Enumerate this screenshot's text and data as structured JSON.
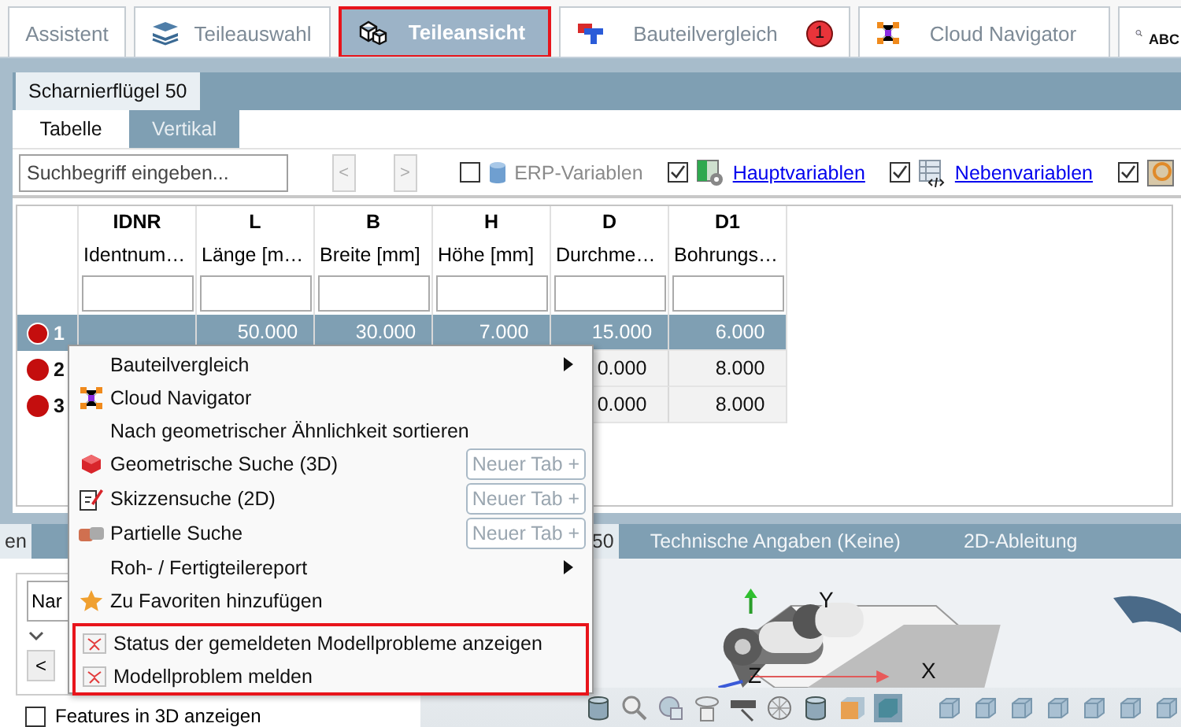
{
  "top_tabs": [
    {
      "label": "Assistent",
      "selected": false,
      "highlighted": false
    },
    {
      "label": "Teileauswahl",
      "selected": false,
      "highlighted": false
    },
    {
      "label": "Teileansicht",
      "selected": true,
      "highlighted": true
    },
    {
      "label": "Bauteilvergleich",
      "selected": false,
      "highlighted": false,
      "badge": "1"
    },
    {
      "label": "Cloud Navigator",
      "selected": false,
      "highlighted": false
    },
    {
      "label": "ABC",
      "selected": false,
      "highlighted": false
    }
  ],
  "document_tab": {
    "label": "Scharnierflügel 50",
    "selected": true
  },
  "view_tabs": [
    {
      "label": "Tabelle",
      "selected": true
    },
    {
      "label": "Vertikal",
      "selected": false
    }
  ],
  "toolbar": {
    "search": {
      "placeholder": "Suchbegriff eingeben..."
    },
    "nav_buttons": [
      {
        "label": "<",
        "disabled": true
      },
      {
        "label": ">",
        "disabled": true
      }
    ],
    "options": [
      {
        "label": "ERP-Variablen",
        "checked": false,
        "kind": "text"
      },
      {
        "label": "Hauptvariablen",
        "checked": true,
        "kind": "link"
      },
      {
        "label": "Nebenvariablen",
        "checked": true,
        "kind": "link"
      },
      {
        "checked": true,
        "kind": "icon"
      }
    ]
  },
  "table": {
    "columns": [
      {
        "name": "IDNR",
        "description": "Identnum…"
      },
      {
        "name": "L",
        "description": "Länge [m…"
      },
      {
        "name": "B",
        "description": "Breite [mm]"
      },
      {
        "name": "H",
        "description": "Höhe [mm]"
      },
      {
        "name": "D",
        "description": "Durchme…"
      },
      {
        "name": "D1",
        "description": "Bohrungs…"
      }
    ],
    "rows": [
      {
        "number": "1",
        "selected": true,
        "cells": [
          null,
          "50.000",
          "30.000",
          "7.000",
          "15.000",
          "6.000"
        ]
      },
      {
        "number": "2",
        "selected": false,
        "cells": [
          null,
          null,
          null,
          null,
          "0.000",
          "8.000"
        ]
      },
      {
        "number": "3",
        "selected": false,
        "cells": [
          null,
          null,
          null,
          null,
          "0.000",
          "8.000"
        ]
      }
    ]
  },
  "lower_tabs": [
    {
      "label": "en",
      "selected": true
    },
    {
      "label": "50",
      "selected": true
    },
    {
      "label": "Technische Angaben (Keine)",
      "selected": false
    },
    {
      "label": "2D-Ableitung",
      "selected": false
    }
  ],
  "left_pane": {
    "field": {
      "value": "Nar"
    },
    "nav_button": "<",
    "features_checkbox": {
      "label": "Features in 3D anzeigen",
      "checked": false
    }
  },
  "viewport": {
    "axes": [
      "Y",
      "Z",
      "X"
    ]
  },
  "context_menu": {
    "items": [
      {
        "label": "Bauteilvergleich",
        "kind": "submenu",
        "highlighted": false
      },
      {
        "label": "Cloud Navigator",
        "kind": "action",
        "highlighted": false
      },
      {
        "label": "Nach geometrischer Ähnlichkeit sortieren",
        "kind": "action",
        "highlighted": false
      },
      {
        "label": "Geometrische Suche (3D)",
        "kind": "search",
        "button": "Neuer Tab +",
        "highlighted": false
      },
      {
        "label": "Skizzensuche (2D)",
        "kind": "search",
        "button": "Neuer Tab +",
        "highlighted": false
      },
      {
        "label": "Partielle Suche",
        "kind": "search",
        "button": "Neuer Tab +",
        "highlighted": false
      },
      {
        "label": "Roh- / Fertigteilereport",
        "kind": "submenu",
        "highlighted": false
      },
      {
        "label": "Zu Favoriten hinzufügen",
        "kind": "action",
        "highlighted": false
      },
      {
        "label": "Status der gemeldeten Modellprobleme anzeigen",
        "kind": "action",
        "highlighted": true
      },
      {
        "label": "Modellproblem melden",
        "kind": "action",
        "highlighted": true
      }
    ]
  }
}
